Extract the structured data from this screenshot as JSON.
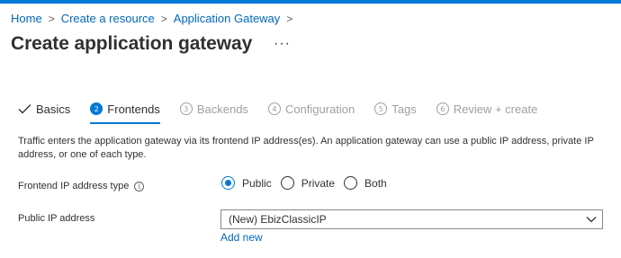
{
  "breadcrumb": {
    "items": [
      "Home",
      "Create a resource",
      "Application Gateway"
    ]
  },
  "page": {
    "title": "Create application gateway",
    "more_label": "···"
  },
  "tabs": [
    {
      "number": "",
      "label": "Basics",
      "state": "done"
    },
    {
      "number": "2",
      "label": "Frontends",
      "state": "active"
    },
    {
      "number": "3",
      "label": "Backends",
      "state": "disabled"
    },
    {
      "number": "4",
      "label": "Configuration",
      "state": "disabled"
    },
    {
      "number": "5",
      "label": "Tags",
      "state": "disabled"
    },
    {
      "number": "6",
      "label": "Review + create",
      "state": "disabled"
    }
  ],
  "description": "Traffic enters the application gateway via its frontend IP address(es). An application gateway can use a public IP address, private IP address, or one of each type.",
  "frontend_ip_type": {
    "label": "Frontend IP address type",
    "info_icon": "info-icon",
    "options": [
      {
        "label": "Public",
        "checked": true
      },
      {
        "label": "Private",
        "checked": false
      },
      {
        "label": "Both",
        "checked": false
      }
    ]
  },
  "public_ip": {
    "label": "Public IP address",
    "selected": "(New) EbizClassicIP",
    "add_new_label": "Add new"
  },
  "colors": {
    "accent": "#0078d4",
    "link": "#0067b8",
    "text": "#323130",
    "disabled": "#a19f9d"
  }
}
